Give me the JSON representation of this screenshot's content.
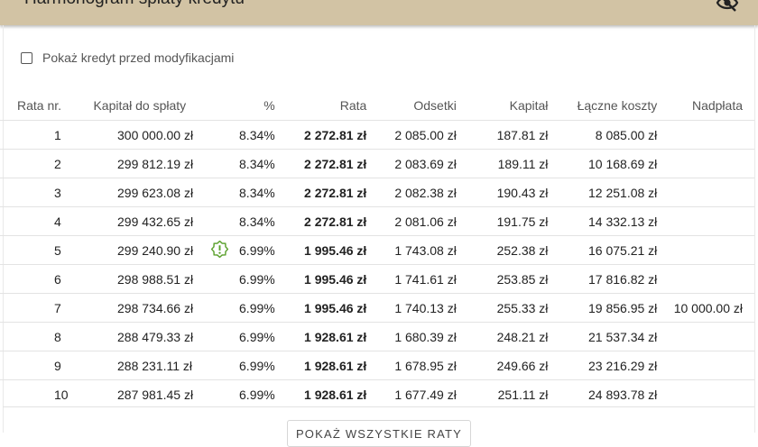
{
  "header": {
    "title": "Harmonogram spłaty kredytu",
    "icon": "eye-off-icon"
  },
  "checkbox": {
    "label": "Pokaż kredyt przed modyfikacjami",
    "checked": false
  },
  "table": {
    "columns": [
      "Rata nr.",
      "Kapitał do spłaty",
      "%",
      "Rata",
      "Odsetki",
      "Kapitał",
      "Łączne koszty",
      "Nadpłata"
    ],
    "rows": [
      {
        "nr": "1",
        "remaining": "300 000.00 zł",
        "percent": "8.34%",
        "installment": "2 272.81 zł",
        "interest": "2 085.00 zł",
        "capital": "187.81 zł",
        "total_cost": "8 085.00 zł",
        "overpayment": "",
        "rate_change": false
      },
      {
        "nr": "2",
        "remaining": "299 812.19 zł",
        "percent": "8.34%",
        "installment": "2 272.81 zł",
        "interest": "2 083.69 zł",
        "capital": "189.11 zł",
        "total_cost": "10 168.69 zł",
        "overpayment": "",
        "rate_change": false
      },
      {
        "nr": "3",
        "remaining": "299 623.08 zł",
        "percent": "8.34%",
        "installment": "2 272.81 zł",
        "interest": "2 082.38 zł",
        "capital": "190.43 zł",
        "total_cost": "12 251.08 zł",
        "overpayment": "",
        "rate_change": false
      },
      {
        "nr": "4",
        "remaining": "299 432.65 zł",
        "percent": "8.34%",
        "installment": "2 272.81 zł",
        "interest": "2 081.06 zł",
        "capital": "191.75 zł",
        "total_cost": "14 332.13 zł",
        "overpayment": "",
        "rate_change": false
      },
      {
        "nr": "5",
        "remaining": "299 240.90 zł",
        "percent": "6.99%",
        "installment": "1 995.46 zł",
        "interest": "1 743.08 zł",
        "capital": "252.38 zł",
        "total_cost": "16 075.21 zł",
        "overpayment": "",
        "rate_change": true
      },
      {
        "nr": "6",
        "remaining": "298 988.51 zł",
        "percent": "6.99%",
        "installment": "1 995.46 zł",
        "interest": "1 741.61 zł",
        "capital": "253.85 zł",
        "total_cost": "17 816.82 zł",
        "overpayment": "",
        "rate_change": false
      },
      {
        "nr": "7",
        "remaining": "298 734.66 zł",
        "percent": "6.99%",
        "installment": "1 995.46 zł",
        "interest": "1 740.13 zł",
        "capital": "255.33 zł",
        "total_cost": "19 856.95 zł",
        "overpayment": "10 000.00 zł",
        "rate_change": false
      },
      {
        "nr": "8",
        "remaining": "288 479.33 zł",
        "percent": "6.99%",
        "installment": "1 928.61 zł",
        "interest": "1 680.39 zł",
        "capital": "248.21 zł",
        "total_cost": "21 537.34 zł",
        "overpayment": "",
        "rate_change": false
      },
      {
        "nr": "9",
        "remaining": "288 231.11 zł",
        "percent": "6.99%",
        "installment": "1 928.61 zł",
        "interest": "1 678.95 zł",
        "capital": "249.66 zł",
        "total_cost": "23 216.29 zł",
        "overpayment": "",
        "rate_change": false
      },
      {
        "nr": "10",
        "remaining": "287 981.45 zł",
        "percent": "6.99%",
        "installment": "1 928.61 zł",
        "interest": "1 677.49 zł",
        "capital": "251.11 zł",
        "total_cost": "24 893.78 zł",
        "overpayment": "",
        "rate_change": false
      }
    ]
  },
  "show_all_button": {
    "label": "POKAŻ WSZYSTKIE RATY"
  },
  "colors": {
    "header_bg": "#d2c3a4",
    "alert_icon": "#5aa02c"
  }
}
